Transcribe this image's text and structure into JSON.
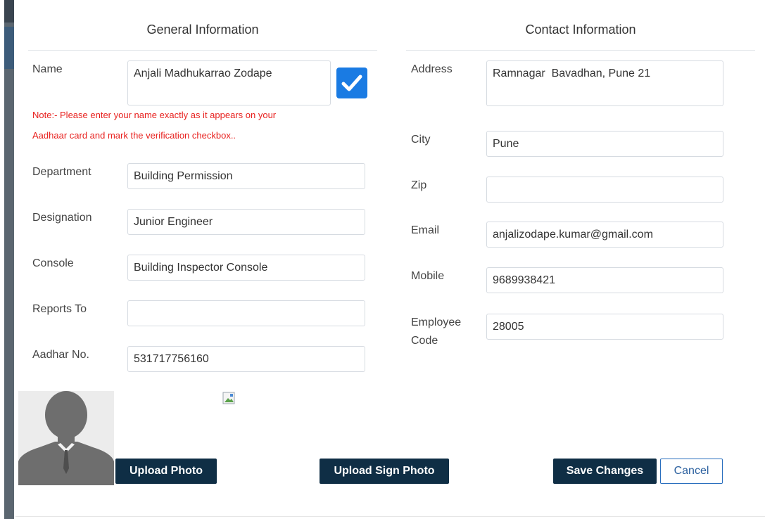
{
  "general": {
    "title": "General Information",
    "name_label": "Name",
    "name_value": "Anjali Madhukarrao Zodape",
    "name_verified": true,
    "note_line1": "Note:- Please enter your name exactly as it appears on your",
    "note_line2": "Aadhaar card and mark the verification checkbox..",
    "department_label": "Department",
    "department_value": "Building Permission",
    "designation_label": "Designation",
    "designation_value": "Junior Engineer",
    "console_label": "Console",
    "console_value": "Building Inspector Console",
    "reports_to_label": "Reports To",
    "reports_to_value": "",
    "aadhar_label": "Aadhar No.",
    "aadhar_value": "531717756160"
  },
  "contact": {
    "title": "Contact Information",
    "address_label": "Address",
    "address_value": "Ramnagar  Bavadhan, Pune 21",
    "city_label": "City",
    "city_value": "Pune",
    "zip_label": "Zip",
    "zip_value": "",
    "email_label": "Email",
    "email_value": "anjalizodape.kumar@gmail.com",
    "mobile_label": "Mobile",
    "mobile_value": "9689938421",
    "employee_code_label_1": "Employee",
    "employee_code_label_2": "Code",
    "employee_code_value": "28005"
  },
  "actions": {
    "upload_photo": "Upload Photo",
    "upload_sign_photo": "Upload Sign Photo",
    "save_changes": "Save Changes",
    "cancel": "Cancel"
  },
  "icons": {
    "avatar": "user-silhouette-icon",
    "checkbox": "checkmark-icon",
    "sign_image": "broken-image-icon"
  },
  "colors": {
    "primary_dark": "#0f2e45",
    "accent_blue": "#1a7be3",
    "note_red": "#e8201e"
  }
}
